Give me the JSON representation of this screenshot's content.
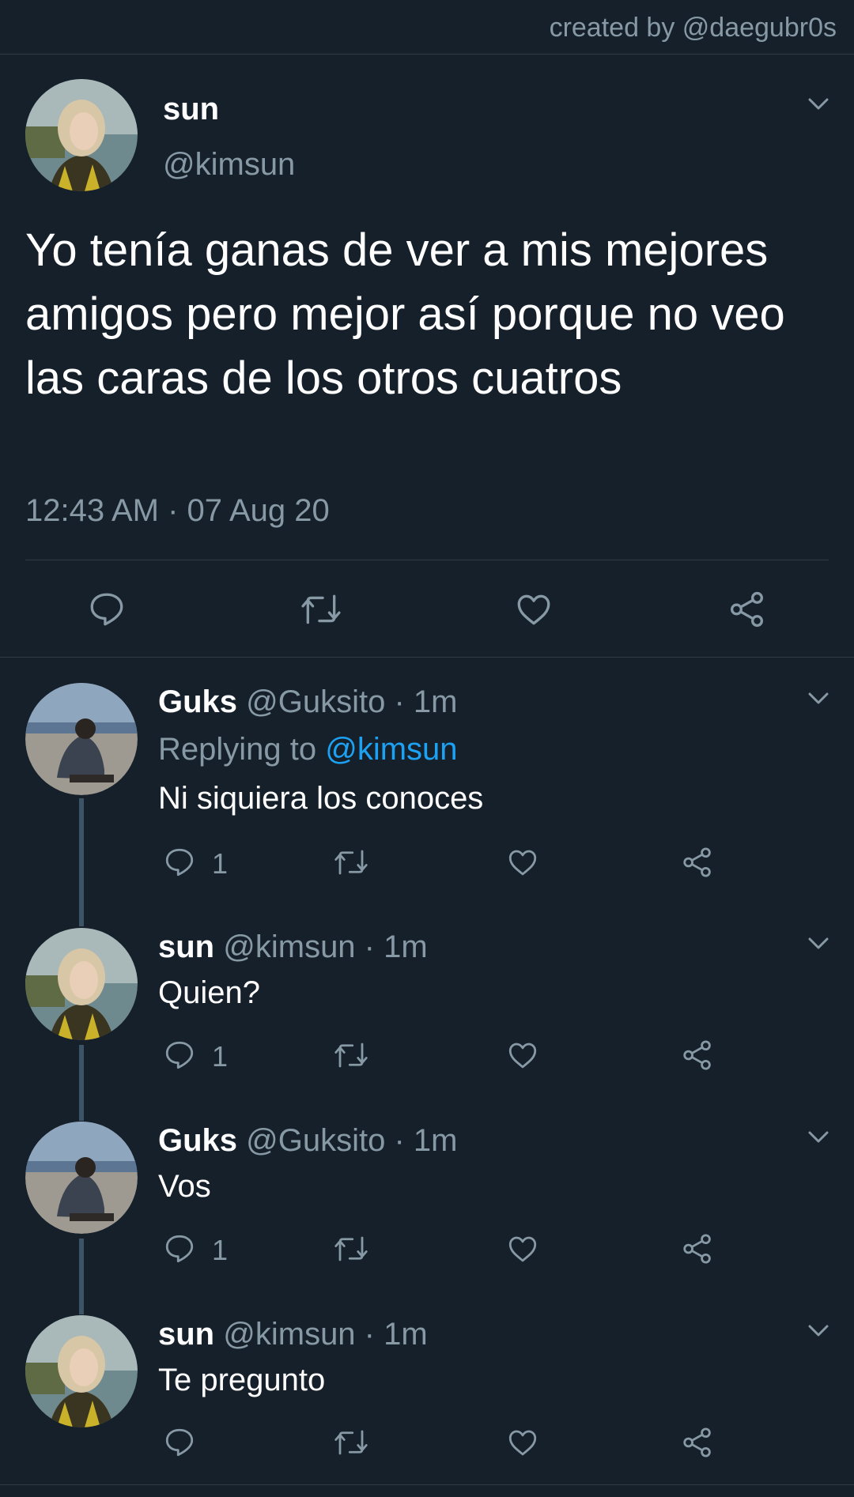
{
  "credit": "created by @daegubr0s",
  "main_tweet": {
    "name": "sun",
    "handle": "@kimsun",
    "text": "Yo tenía ganas de ver a mis mejores amigos pero mejor así porque no veo las caras de los otros cuatros",
    "time": "12:43 AM · 07 Aug 20",
    "avatar_icon": "avatar-woman-icon",
    "actions": [
      "reply-icon",
      "retweet-icon",
      "like-icon",
      "share-icon"
    ]
  },
  "replies": [
    {
      "name": "Guks",
      "handle": "@Guksito · 1m",
      "replying_prefix": "Replying to ",
      "replying_to": "@kimsun",
      "text": "Ni siquiera los conoces",
      "reply_count": "1"
    },
    {
      "name": "sun",
      "handle": "@kimsun · 1m",
      "text": "Quien?",
      "reply_count": "1"
    },
    {
      "name": "Guks",
      "handle": "@Guksito · 1m",
      "text": "Vos",
      "reply_count": "1"
    },
    {
      "name": "sun",
      "handle": "@kimsun · 1m",
      "text": "Te pregunto",
      "reply_count": ""
    }
  ],
  "colors": {
    "background": "#15202b",
    "secondary_text": "#8899a6",
    "link": "#1da1f2",
    "divider": "#2f3b47",
    "thread_line": "#3d5466"
  }
}
